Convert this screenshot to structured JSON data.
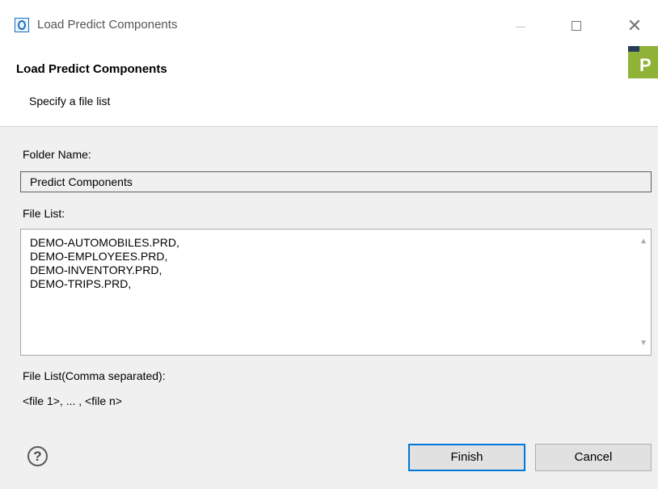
{
  "window": {
    "title": "Load Predict Components",
    "controls": {
      "minimize": "—",
      "maximize": "☐",
      "close": "✕"
    }
  },
  "header": {
    "heading": "Load Predict Components",
    "subheading": "Specify a file list",
    "wizard_image_letter": "P"
  },
  "form": {
    "folder_label": "Folder Name:",
    "folder_value": "Predict Components",
    "file_list_label": "File List:",
    "file_list_lines": [
      "DEMO-AUTOMOBILES.PRD,",
      "DEMO-EMPLOYEES.PRD,",
      "DEMO-INVENTORY.PRD,",
      "DEMO-TRIPS.PRD,"
    ],
    "hint_label": "File List(Comma separated):",
    "hint_value": "<file 1>, ... , <file n>"
  },
  "footer": {
    "help_glyph": "?",
    "finish_label": "Finish",
    "cancel_label": "Cancel"
  },
  "colors": {
    "accent": "#0078d7",
    "wizard_green": "#8fb237",
    "wizard_navy": "#253d5b"
  }
}
